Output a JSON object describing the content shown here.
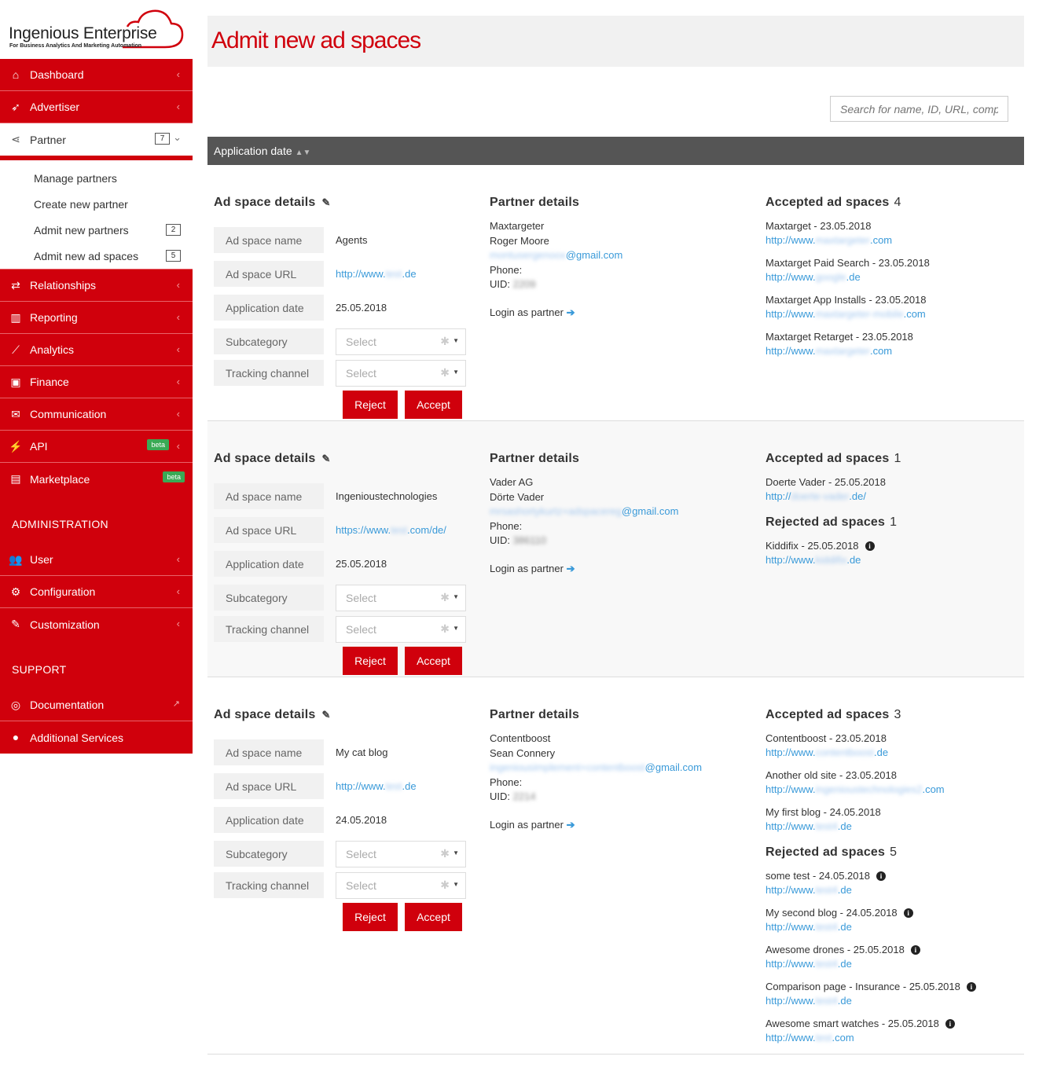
{
  "brand": {
    "name": "Ingenious Enterprise",
    "tagline": "For Business Analytics And Marketing Automation",
    "accent": "#d0000c"
  },
  "sidebar": {
    "nav": [
      {
        "label": "Dashboard",
        "icon": "home-icon"
      },
      {
        "label": "Advertiser",
        "icon": "rocket-icon"
      },
      {
        "label": "Partner",
        "icon": "share-icon",
        "badge": "7"
      }
    ],
    "partner_sub": [
      {
        "label": "Manage partners"
      },
      {
        "label": "Create new partner"
      },
      {
        "label": "Admit new partners",
        "badge": "2"
      },
      {
        "label": "Admit new ad spaces",
        "badge": "5"
      }
    ],
    "nav2": [
      {
        "label": "Relationships",
        "icon": "exchange-icon"
      },
      {
        "label": "Reporting",
        "icon": "bar-chart-icon"
      },
      {
        "label": "Analytics",
        "icon": "line-chart-icon"
      },
      {
        "label": "Finance",
        "icon": "money-icon"
      },
      {
        "label": "Communication",
        "icon": "envelope-icon"
      },
      {
        "label": "API",
        "icon": "plug-icon",
        "beta": "beta"
      },
      {
        "label": "Marketplace",
        "icon": "briefcase-icon",
        "beta": "beta"
      }
    ],
    "admin_title": "ADMINISTRATION",
    "admin": [
      {
        "label": "User",
        "icon": "users-icon"
      },
      {
        "label": "Configuration",
        "icon": "cogs-icon"
      },
      {
        "label": "Customization",
        "icon": "brush-icon"
      }
    ],
    "support_title": "SUPPORT",
    "support": [
      {
        "label": "Documentation",
        "icon": "life-ring-icon"
      },
      {
        "label": "Additional Services",
        "icon": "user-icon"
      }
    ]
  },
  "main": {
    "title": "Admit new ad spaces",
    "search_placeholder": "Search for name, ID, URL, company",
    "sort_label": "Application date",
    "labels": {
      "details": "Ad space details",
      "partner": "Partner details",
      "accepted": "Accepted ad spaces",
      "rejected": "Rejected ad spaces",
      "name": "Ad space name",
      "url": "Ad space URL",
      "date": "Application date",
      "subcategory": "Subcategory",
      "channel": "Tracking channel",
      "select": "Select",
      "reject": "Reject",
      "accept": "Accept",
      "phone": "Phone:",
      "uid": "UID:",
      "login": "Login as partner"
    },
    "records": [
      {
        "name": "Agents",
        "url_pre": "http://www.",
        "url_blur": "test",
        "url_post": ".de",
        "date": "25.05.2018",
        "company": "Maxtargeter",
        "person": "Roger Moore",
        "email_blur": "montusergenoox",
        "email_post": "@gmail.com",
        "uid_blur": "2209",
        "accepted_count": "4",
        "accepted": [
          {
            "t": "Maxtarget - 23.05.2018",
            "p": "http://www.",
            "b": "maxtargeter",
            "s": ".com"
          },
          {
            "t": "Maxtarget Paid Search - 23.05.2018",
            "p": "http://www.",
            "b": "google",
            "s": ".de"
          },
          {
            "t": "Maxtarget App Installs - 23.05.2018",
            "p": "http://www.",
            "b": "maxtargeter-mobile",
            "s": ".com"
          },
          {
            "t": "Maxtarget Retarget - 23.05.2018",
            "p": "http://www.",
            "b": "maxtargeter",
            "s": ".com"
          }
        ],
        "rejected_count": "",
        "rejected": []
      },
      {
        "name": "Ingenioustechnologies",
        "url_pre": "https://www.",
        "url_blur": "test",
        "url_post": ".com/de/",
        "date": "25.05.2018",
        "company": "Vader AG",
        "person": "Dörte Vader",
        "email_blur": "mrsashortykurtz+adspacereg",
        "email_post": "@gmail.com",
        "uid_blur": "386110",
        "accepted_count": "1",
        "accepted": [
          {
            "t": "Doerte Vader - 25.05.2018",
            "p": "http://",
            "b": "doerte-vader",
            "s": ".de/"
          }
        ],
        "rejected_count": "1",
        "rejected": [
          {
            "t": "Kiddifix - 25.05.2018",
            "p": "http://www.",
            "b": "kiddifix",
            "s": ".de"
          }
        ]
      },
      {
        "name": "My cat blog",
        "url_pre": "http://www.",
        "url_blur": "test",
        "url_post": ".de",
        "date": "24.05.2018",
        "company": "Contentboost",
        "person": "Sean Connery",
        "email_blur": "ingeniousimplement+contentboost",
        "email_post": "@gmail.com",
        "uid_blur": "2214",
        "accepted_count": "3",
        "accepted": [
          {
            "t": "Contentboost - 23.05.2018",
            "p": "http://www.",
            "b": "contentboost",
            "s": ".de"
          },
          {
            "t": "Another old site - 23.05.2018",
            "p": "http://www.",
            "b": "ingenioustechnologies2",
            "s": ".com"
          },
          {
            "t": "My first blog - 24.05.2018",
            "p": "http://www.",
            "b": "test4",
            "s": ".de"
          }
        ],
        "rejected_count": "5",
        "rejected": [
          {
            "t": "some test - 24.05.2018",
            "p": "http://www.",
            "b": "test4",
            "s": ".de"
          },
          {
            "t": "My second blog - 24.05.2018",
            "p": "http://www.",
            "b": "test4",
            "s": ".de"
          },
          {
            "t": "Awesome drones - 25.05.2018",
            "p": "http://www.",
            "b": "test4",
            "s": ".de"
          },
          {
            "t": "Comparison page - Insurance - 25.05.2018",
            "p": "http://www.",
            "b": "test4",
            "s": ".de"
          },
          {
            "t": "Awesome smart watches - 25.05.2018",
            "p": "http://www.",
            "b": "test",
            "s": ".com"
          }
        ]
      }
    ]
  }
}
